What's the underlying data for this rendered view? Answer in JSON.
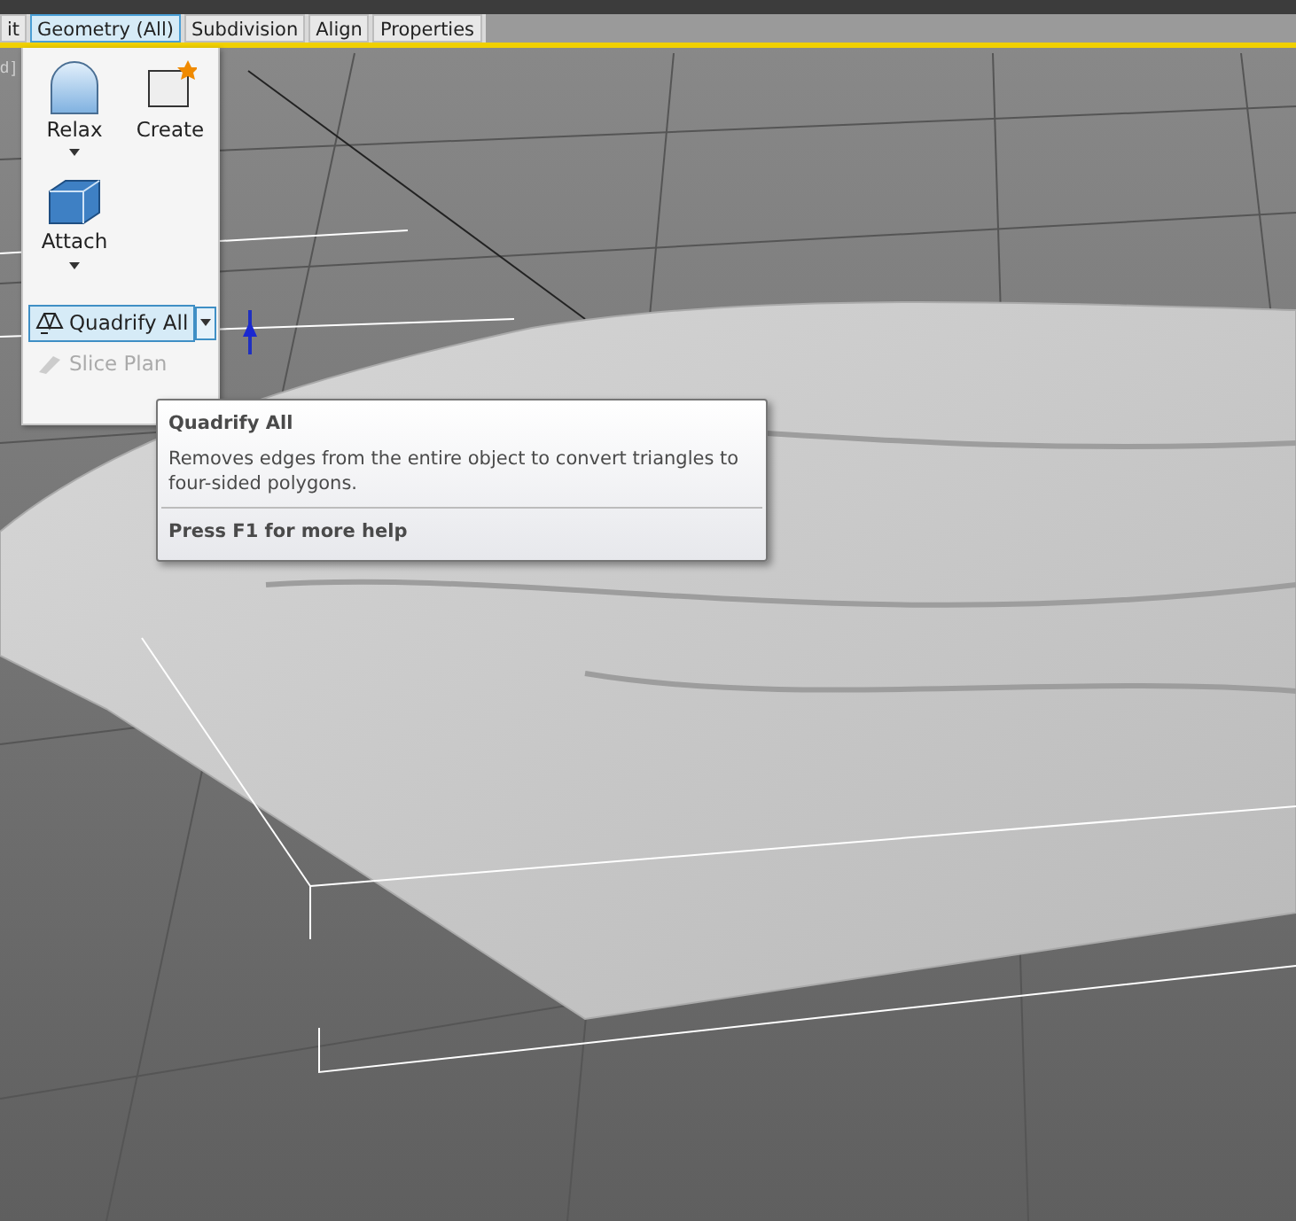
{
  "tabs": [
    {
      "label": "it",
      "selected": false
    },
    {
      "label": "Geometry (All)",
      "selected": true
    },
    {
      "label": "Subdivision",
      "selected": false
    },
    {
      "label": "Align",
      "selected": false
    },
    {
      "label": "Properties",
      "selected": false
    }
  ],
  "viewport_label": "d ]",
  "panel": {
    "large_buttons": [
      {
        "label": "Relax",
        "has_dropdown": true
      },
      {
        "label": "Create",
        "has_dropdown": false
      },
      {
        "label": "Attach",
        "has_dropdown": true
      }
    ],
    "small_buttons": [
      {
        "label": "Quadrify All",
        "selected": true,
        "disabled": false,
        "has_dropdown": true
      },
      {
        "label": "Slice Plan",
        "selected": false,
        "disabled": true,
        "has_dropdown": false
      }
    ]
  },
  "tooltip": {
    "title": "Quadrify All",
    "description": "Removes edges from the entire object to convert triangles to four-sided polygons.",
    "help": "Press F1 for more help"
  }
}
